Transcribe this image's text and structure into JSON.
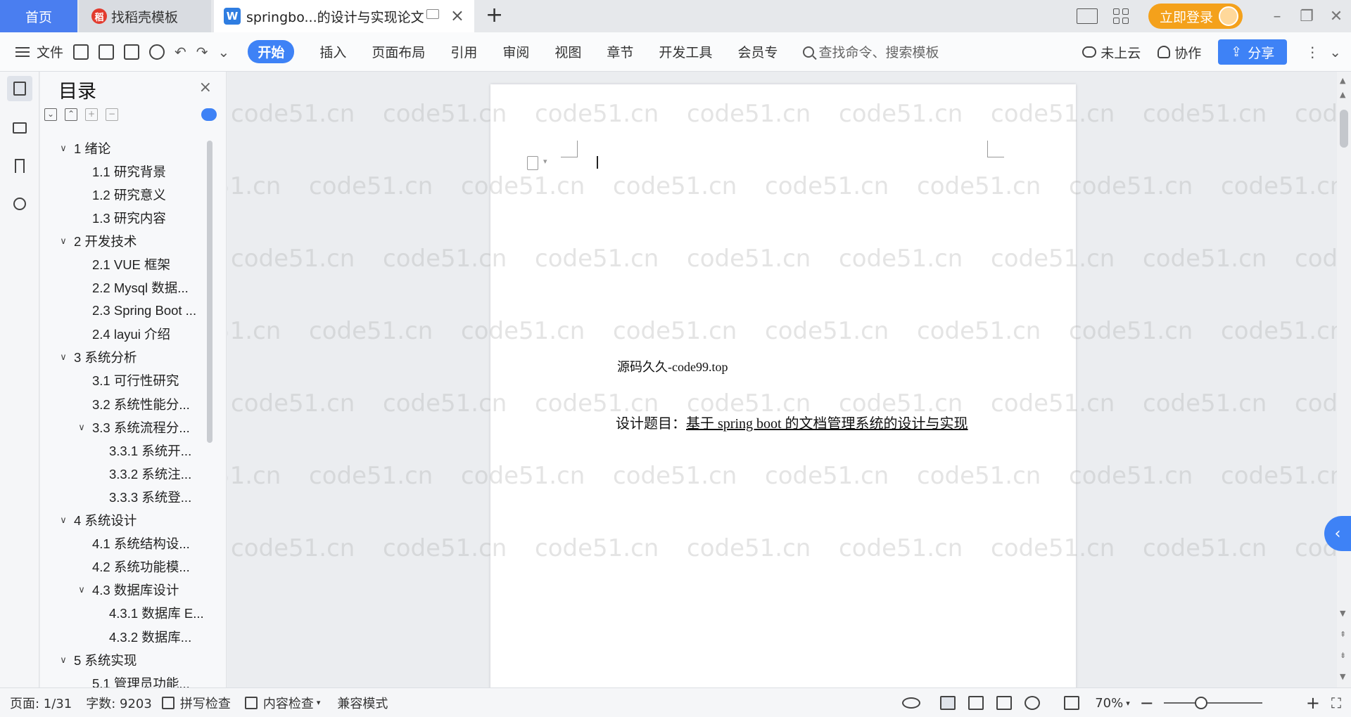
{
  "tabs": {
    "home": "首页",
    "template": "找稻壳模板",
    "document": "springbo...的设计与实现论文"
  },
  "header": {
    "login": "立即登录"
  },
  "toolbar": {
    "file": "文件",
    "ribbon_tabs": [
      "开始",
      "插入",
      "页面布局",
      "引用",
      "审阅",
      "视图",
      "章节",
      "开发工具",
      "会员专"
    ],
    "search_placeholder": "查找命令、搜索模板",
    "cloud": "未上云",
    "collab": "协作",
    "share": "分享"
  },
  "toc": {
    "title": "目录",
    "items": [
      {
        "level": 1,
        "expanded": true,
        "label": "1  绪论"
      },
      {
        "level": 2,
        "label": "1.1  研究背景"
      },
      {
        "level": 2,
        "label": "1.2  研究意义"
      },
      {
        "level": 2,
        "label": "1.3  研究内容"
      },
      {
        "level": 1,
        "expanded": true,
        "label": "2  开发技术"
      },
      {
        "level": 2,
        "label": "2.1 VUE 框架"
      },
      {
        "level": 2,
        "label": "2.2 Mysql 数据..."
      },
      {
        "level": 2,
        "label": "2.3 Spring Boot ..."
      },
      {
        "level": 2,
        "label": "2.4 layui 介绍"
      },
      {
        "level": 1,
        "expanded": true,
        "label": "3  系统分析"
      },
      {
        "level": 2,
        "label": "3.1 可行性研究"
      },
      {
        "level": 2,
        "label": "3.2 系统性能分..."
      },
      {
        "level": 2,
        "expanded": true,
        "label": "3.3  系统流程分..."
      },
      {
        "level": 3,
        "label": "3.3.1  系统开..."
      },
      {
        "level": 3,
        "label": "3.3.2  系统注..."
      },
      {
        "level": 3,
        "label": "3.3.3  系统登..."
      },
      {
        "level": 1,
        "expanded": true,
        "label": "4  系统设计"
      },
      {
        "level": 2,
        "label": "4.1  系统结构设..."
      },
      {
        "level": 2,
        "label": "4.2 系统功能模..."
      },
      {
        "level": 2,
        "expanded": true,
        "label": "4.3 数据库设计"
      },
      {
        "level": 3,
        "label": "4.3.1 数据库 E..."
      },
      {
        "level": 3,
        "label": "4.3.2  数据库..."
      },
      {
        "level": 1,
        "expanded": true,
        "label": "5  系统实现"
      },
      {
        "level": 2,
        "label": "5.1  管理员功能..."
      }
    ]
  },
  "document": {
    "code_line": "源码久久-code99.top",
    "title_prefix": "设计题目：",
    "title_text": "基于 spring boot 的文档管理系统的设计与实现"
  },
  "watermark": "code51.cn",
  "status": {
    "page": "页面: 1/31",
    "words": "字数: 9203",
    "spell": "拼写检查",
    "content_check": "内容检查",
    "compat": "兼容模式",
    "zoom": "70%",
    "zoom_level": 0.38
  },
  "colors": {
    "accent": "#3e82f6",
    "home_tab": "#4a7ef0",
    "login": "#f4a11b"
  }
}
